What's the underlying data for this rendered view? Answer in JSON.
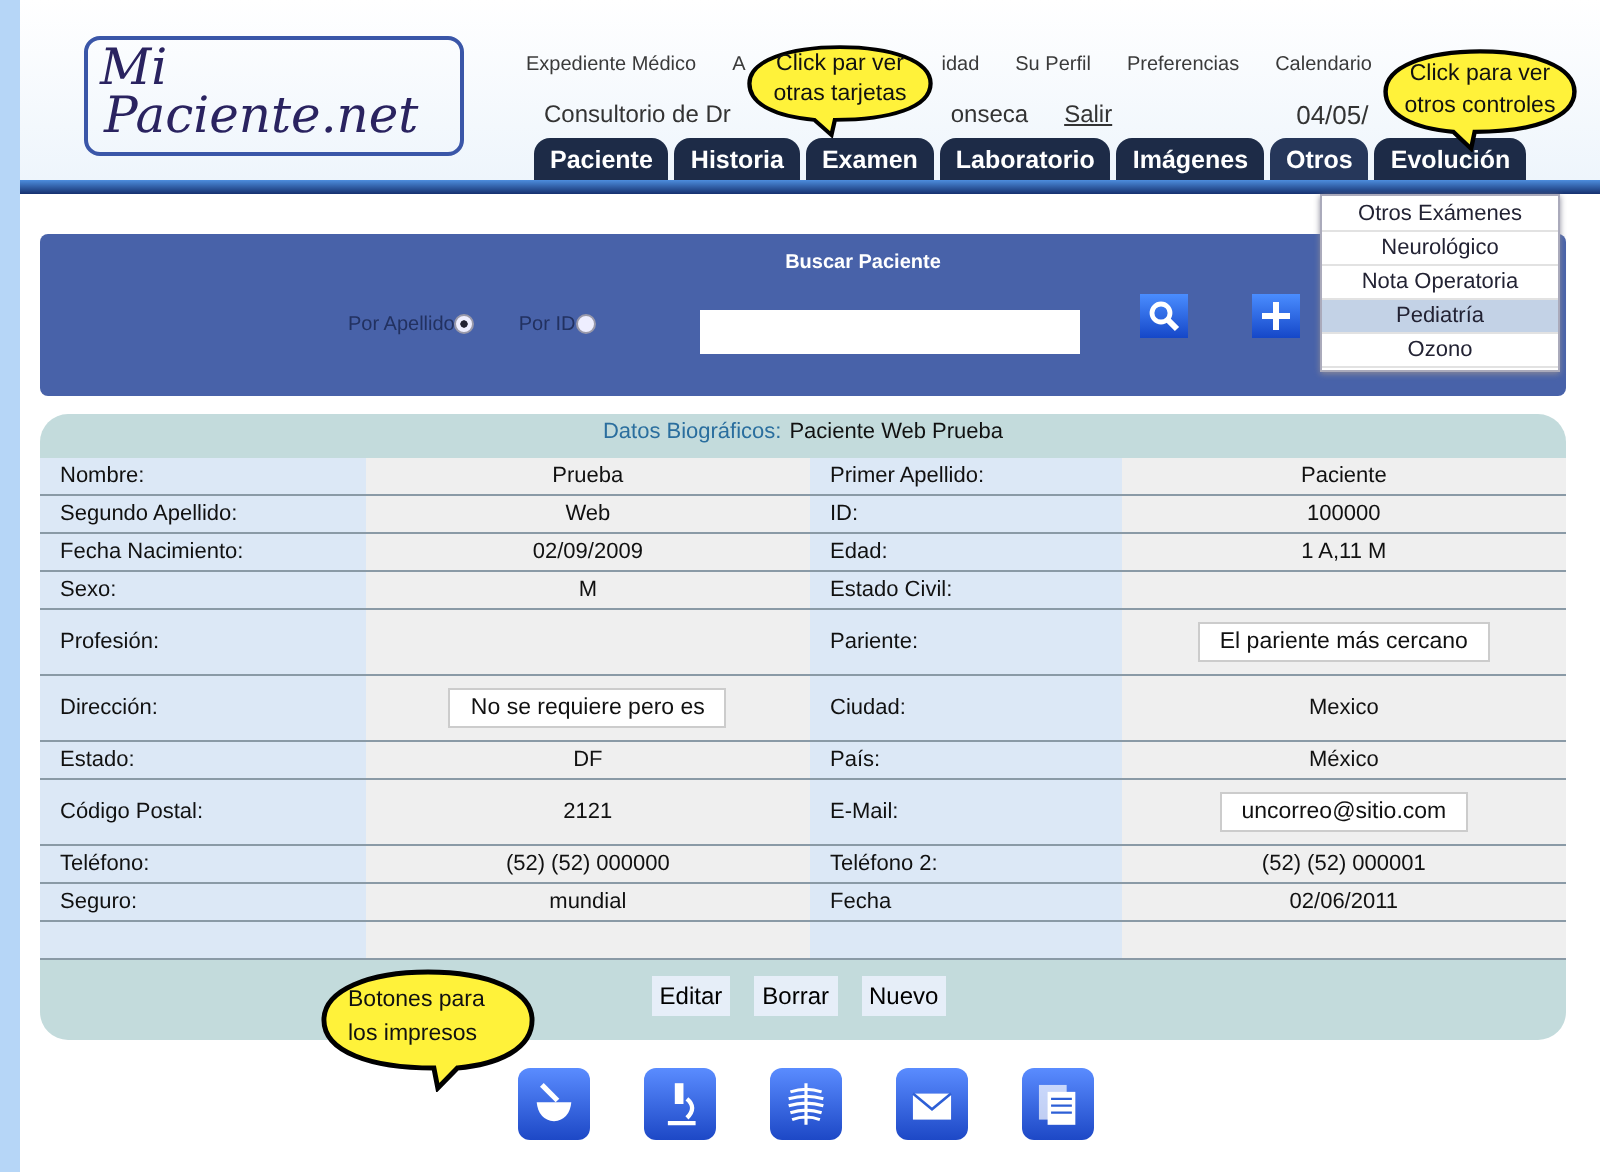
{
  "logo": {
    "line1": "Mi",
    "line2": "Paciente.net"
  },
  "top_nav": [
    {
      "label": "Expediente Médico"
    },
    {
      "label": "A"
    },
    {
      "label": "idad"
    },
    {
      "label": "Su Perfil"
    },
    {
      "label": "Preferencias"
    },
    {
      "label": "Calendario"
    }
  ],
  "user_bar": {
    "doctor": "Consultorio de Dr",
    "doctor_rest": "onseca",
    "logout": "Salir",
    "date": "04/05/"
  },
  "tabs": [
    {
      "label": "Paciente"
    },
    {
      "label": "Historia"
    },
    {
      "label": "Examen"
    },
    {
      "label": "Laboratorio"
    },
    {
      "label": "Imágenes"
    },
    {
      "label": "Otros",
      "expanded": true
    },
    {
      "label": "Evolución"
    }
  ],
  "otros_menu": [
    {
      "label": "Otros Exámenes",
      "selected": false
    },
    {
      "label": "Neurológico",
      "selected": false
    },
    {
      "label": "Nota Operatoria",
      "selected": false
    },
    {
      "label": "Pediatría",
      "selected": true
    },
    {
      "label": "Ozono",
      "selected": false
    }
  ],
  "search": {
    "title": "Buscar Paciente",
    "options": [
      {
        "label": "Por Apellido",
        "selected": true
      },
      {
        "label": "Por ID",
        "selected": false
      }
    ]
  },
  "biographic": {
    "heading": "Datos Biográficos:",
    "patient": "Paciente Web Prueba",
    "rows": [
      {
        "cells": [
          {
            "label": "Nombre:",
            "value": "Prueba"
          },
          {
            "label": "Primer Apellido:",
            "value": "Paciente"
          }
        ]
      },
      {
        "cells": [
          {
            "label": "Segundo Apellido:",
            "value": "Web"
          },
          {
            "label": "ID:",
            "value": "100000"
          }
        ]
      },
      {
        "cells": [
          {
            "label": "Fecha Nacimiento:",
            "value": "02/09/2009"
          },
          {
            "label": "Edad:",
            "value": "1 A,11 M"
          }
        ]
      },
      {
        "cells": [
          {
            "label": "Sexo:",
            "value": "M"
          },
          {
            "label": "Estado Civil:"
          }
        ]
      },
      {
        "cells": [
          {
            "label": "Profesión:"
          },
          {
            "label": "Pariente:",
            "value": "El pariente más cercano",
            "kind": "field"
          }
        ]
      },
      {
        "cells": [
          {
            "label": "Dirección:",
            "value": "No se requiere pero es",
            "kind": "field"
          },
          {
            "label": "Ciudad:",
            "value": "Mexico"
          }
        ]
      },
      {
        "cells": [
          {
            "label": "Estado:",
            "value": "DF"
          },
          {
            "label": "País:",
            "value": "México"
          }
        ]
      },
      {
        "cells": [
          {
            "label": "Código Postal:",
            "value": "2121"
          },
          {
            "label": "E-Mail:",
            "value": "uncorreo@sitio.com",
            "kind": "field"
          }
        ]
      },
      {
        "cells": [
          {
            "label": "Teléfono:",
            "value": "(52) (52) 000000"
          },
          {
            "label": "Teléfono 2:",
            "value": "(52) (52) 000001"
          }
        ]
      },
      {
        "cells": [
          {
            "label": "Seguro:",
            "value": "mundial"
          },
          {
            "label": "Fecha",
            "value": "02/06/2011"
          }
        ]
      },
      {
        "cells": [
          {},
          {}
        ]
      }
    ]
  },
  "buttons": [
    "Editar",
    "Borrar",
    "Nuevo"
  ],
  "callouts": [
    {
      "lines": [
        "Click par ver",
        "otras tarjetas"
      ]
    },
    {
      "lines": [
        "Click para ver",
        "otros controles"
      ]
    },
    {
      "lines": [
        "Botones para",
        "los impresos"
      ]
    }
  ]
}
